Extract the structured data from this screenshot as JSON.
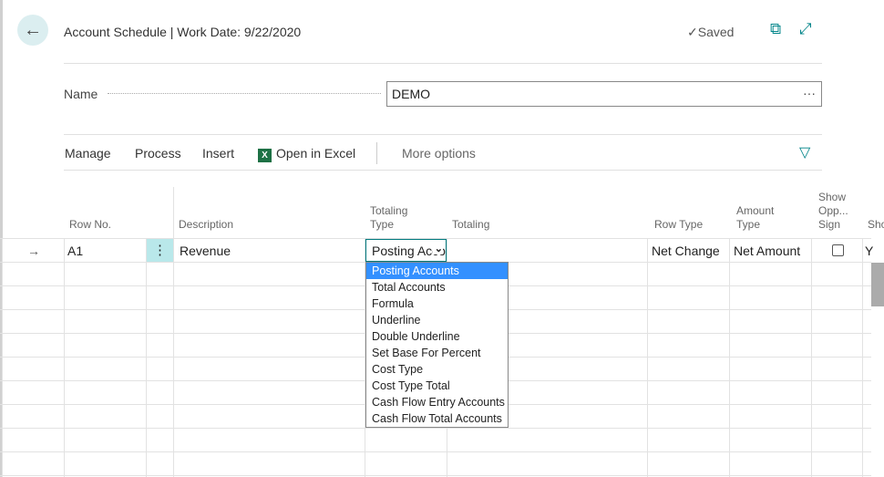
{
  "header": {
    "title": "Account Schedule | Work Date: 9/22/2020",
    "saved": "✓Saved",
    "back_icon": "←",
    "open_new_icon": "⧉",
    "expand_icon": "⤢"
  },
  "name_field": {
    "label": "Name",
    "value": "DEMO",
    "ellipsis": "···"
  },
  "actions": {
    "manage": "Manage",
    "process": "Process",
    "insert": "Insert",
    "excel_icon": "X",
    "open_excel": "Open in Excel",
    "more": "More options",
    "filter_icon": "▽"
  },
  "columns": {
    "row_no": "Row No.",
    "description": "Description",
    "totaling_type": [
      "Totaling",
      "Type"
    ],
    "totaling": "Totaling",
    "row_type": "Row Type",
    "amount_type": [
      "Amount",
      "Type"
    ],
    "show_opp": [
      "Show",
      "Opp...",
      "Sign"
    ],
    "show": "Sho"
  },
  "row": {
    "indicator": "→",
    "row_no": "A1",
    "menu": "⋮",
    "description": "Revenue",
    "totaling_type": "Posting Accounts",
    "row_type": "Net Change",
    "amount_type": "Net Amount",
    "show_opp_sign": false,
    "show": "Y"
  },
  "dropdown": {
    "options": [
      "Posting Accounts",
      "Total Accounts",
      "Formula",
      "Underline",
      "Double Underline",
      "Set Base For Percent",
      "Cost Type",
      "Cost Type Total",
      "Cash Flow Entry Accounts",
      "Cash Flow Total Accounts"
    ],
    "selected": "Posting Accounts"
  },
  "colors": {
    "accent": "#008489",
    "selection": "#3390ff",
    "row_menu": "#b9e8ea"
  }
}
